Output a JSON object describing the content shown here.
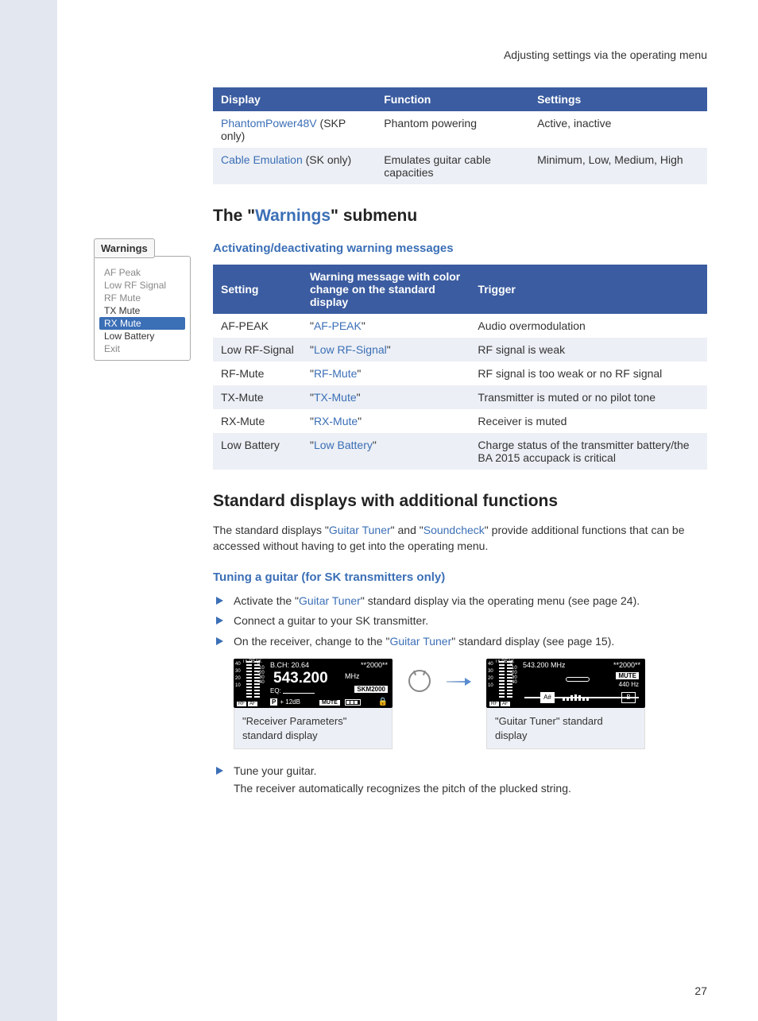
{
  "header": "Adjusting settings via the operating menu",
  "page_number": "27",
  "table1": {
    "headers": [
      "Display",
      "Function",
      "Settings"
    ],
    "rows": [
      {
        "d1a": "PhantomPower48V",
        "d1b": " (SKP only)",
        "f": "Phantom powering",
        "s": "Active, inactive"
      },
      {
        "d1a": "Cable Emulation",
        "d1b": " (SK only)",
        "f": "Emulates guitar cable capacities",
        "s": "Minimum, Low, Medium, High"
      }
    ]
  },
  "h2a_pre": "The \"",
  "h2a_blue": "Warnings",
  "h2a_post": "\" submenu",
  "h3a": "Activating/deactivating warning messages",
  "sidebox": {
    "title": "Warnings",
    "items": [
      {
        "t": "AF Peak",
        "cls": ""
      },
      {
        "t": "Low RF Signal",
        "cls": ""
      },
      {
        "t": "RF Mute",
        "cls": ""
      },
      {
        "t": "TX Mute",
        "cls": "dark"
      },
      {
        "t": "RX Mute",
        "cls": "hl"
      },
      {
        "t": "Low Battery",
        "cls": "dark"
      },
      {
        "t": "Exit",
        "cls": ""
      }
    ]
  },
  "table2": {
    "headers": [
      "Setting",
      "Warning message with color change on the standard display",
      "Trigger"
    ],
    "rows": [
      {
        "s": "AF-PEAK",
        "m": "AF-PEAK",
        "t": "Audio overmodulation"
      },
      {
        "s": "Low RF-Signal",
        "m": "Low RF-Signal",
        "t": "RF signal is weak"
      },
      {
        "s": "RF-Mute",
        "m": "RF-Mute",
        "t": "RF signal is too weak or no RF signal"
      },
      {
        "s": "TX-Mute",
        "m": "TX-Mute",
        "t": "Transmitter is muted or no pilot tone"
      },
      {
        "s": "RX-Mute",
        "m": "RX-Mute",
        "t": "Receiver is muted"
      },
      {
        "s": "Low Battery",
        "m": "Low Battery",
        "t": "Charge status of the transmitter battery/the BA 2015 accupack is critical"
      }
    ]
  },
  "h2b": "Standard displays with additional functions",
  "para1_a": "The standard displays \"",
  "para1_b": "Guitar Tuner",
  "para1_c": "\" and \"",
  "para1_d": "Soundcheck",
  "para1_e": "\" provide additional functions that can be accessed without having to get into the operating menu.",
  "h3b": "Tuning a guitar (for SK transmitters only)",
  "bl1_a": "Activate the \"",
  "bl1_b": "Guitar Tuner",
  "bl1_c": "\" standard display via the operating menu (see page 24).",
  "bl2": "Connect a guitar to your SK transmitter.",
  "bl3_a": "On the receiver, change to the \"",
  "bl3_b": "Guitar Tuner",
  "bl3_c": "\" standard display (see page 15).",
  "lcd1": {
    "top": "B.CH: 20.64",
    "star": "**2000**",
    "freq": "543.200",
    "mhz": "MHz",
    "eq": "EQ:",
    "skm": "SKM2000",
    "bot": "+ 12dB",
    "mute": "MUTE",
    "rf": "RF",
    "af": "AF",
    "pk": "PEAK",
    "scale": "40\n30\n20\n10",
    "scale2": "0\n-10\n-20\n-30\n-40",
    "caption": "\"Receiver Parameters\" standard display",
    "p_icon": "P",
    "ant": "I  II"
  },
  "lcd2": {
    "top": "543.200 MHz",
    "star": "**2000**",
    "mute": "MUTE",
    "hz": "440 Hz",
    "note1": "A#",
    "note2": "B",
    "rf": "RF",
    "af": "AF",
    "pk": "PEAK",
    "scale": "40\n30\n20\n10",
    "scale2": "0\n-10\n-20\n-30\n-40",
    "caption": "\"Guitar Tuner\" standard display",
    "ant": "I  II"
  },
  "bl4": "Tune your guitar.",
  "sub4": "The receiver automatically recognizes the pitch of the plucked string."
}
